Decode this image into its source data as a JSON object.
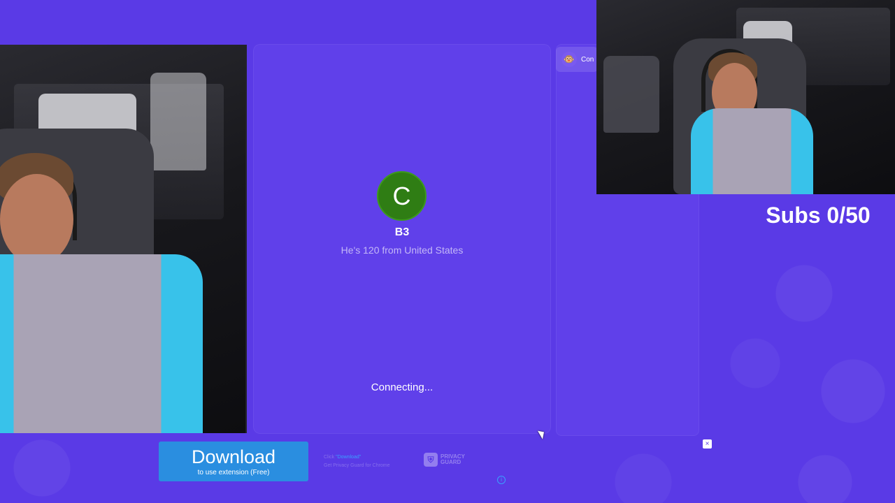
{
  "partner": {
    "avatar_letter": "C",
    "name": "B3",
    "info": "He's 120 from United States"
  },
  "status": {
    "connecting": "Connecting..."
  },
  "sidebar": {
    "chip_label": "Con",
    "chip_icon": "monkey-icon"
  },
  "overlay": {
    "subs_counter": "Subs 0/50"
  },
  "ad": {
    "download_label": "Download",
    "download_sub": "to use extension (Free)",
    "step1_prefix": "Click ",
    "step1_highlight": "\"Download\"",
    "step2": "Get Privacy Guard for Chrome",
    "brand_line1": "PRIVACY",
    "brand_line2": "GUARD",
    "close_symbol": "×",
    "info_symbol": "i"
  },
  "colors": {
    "background": "#5a3ae6",
    "panel": "#6040ea",
    "avatar": "#2f7d14",
    "download_button": "#2a8ee0"
  }
}
